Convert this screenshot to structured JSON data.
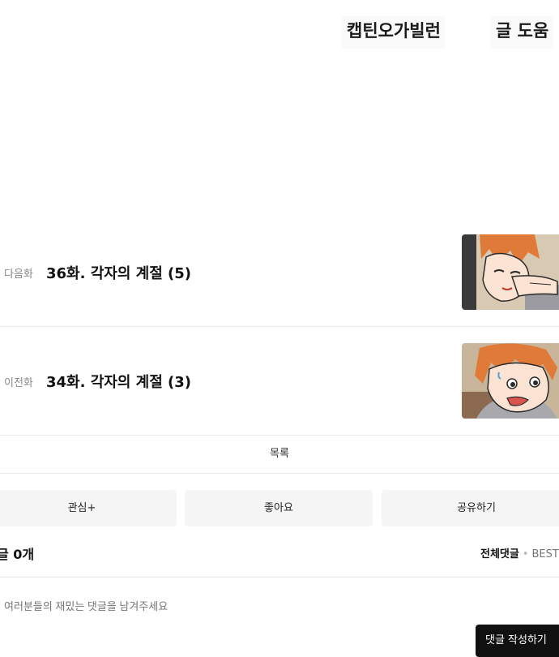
{
  "credits": {
    "author": "캡틴오가빌런",
    "assist": "글 도움"
  },
  "episodes": {
    "next": {
      "label": "다음화",
      "title": "36화. 각자의 계절 (5)"
    },
    "prev": {
      "label": "이전화",
      "title": "34화. 각자의 계절 (3)"
    }
  },
  "list_label": "목록",
  "actions": {
    "subscribe": "관심+",
    "like": "좋아요",
    "share": "공유하기"
  },
  "comments": {
    "count_label": "글 0개",
    "sort_all": "전체댓글",
    "sort_best": "BEST댓",
    "placeholder": "여러분들의 재밌는 댓글을 남겨주세요",
    "write_button": "댓글 작성하기"
  },
  "colors": {
    "accent_dark": "#111111",
    "button_bg": "#f5f5f5",
    "divider": "#ebebeb",
    "thumb_hair": "#e07a38"
  },
  "icons": {
    "next_thumbnail": "comic-thumbnail-next",
    "prev_thumbnail": "comic-thumbnail-prev"
  }
}
